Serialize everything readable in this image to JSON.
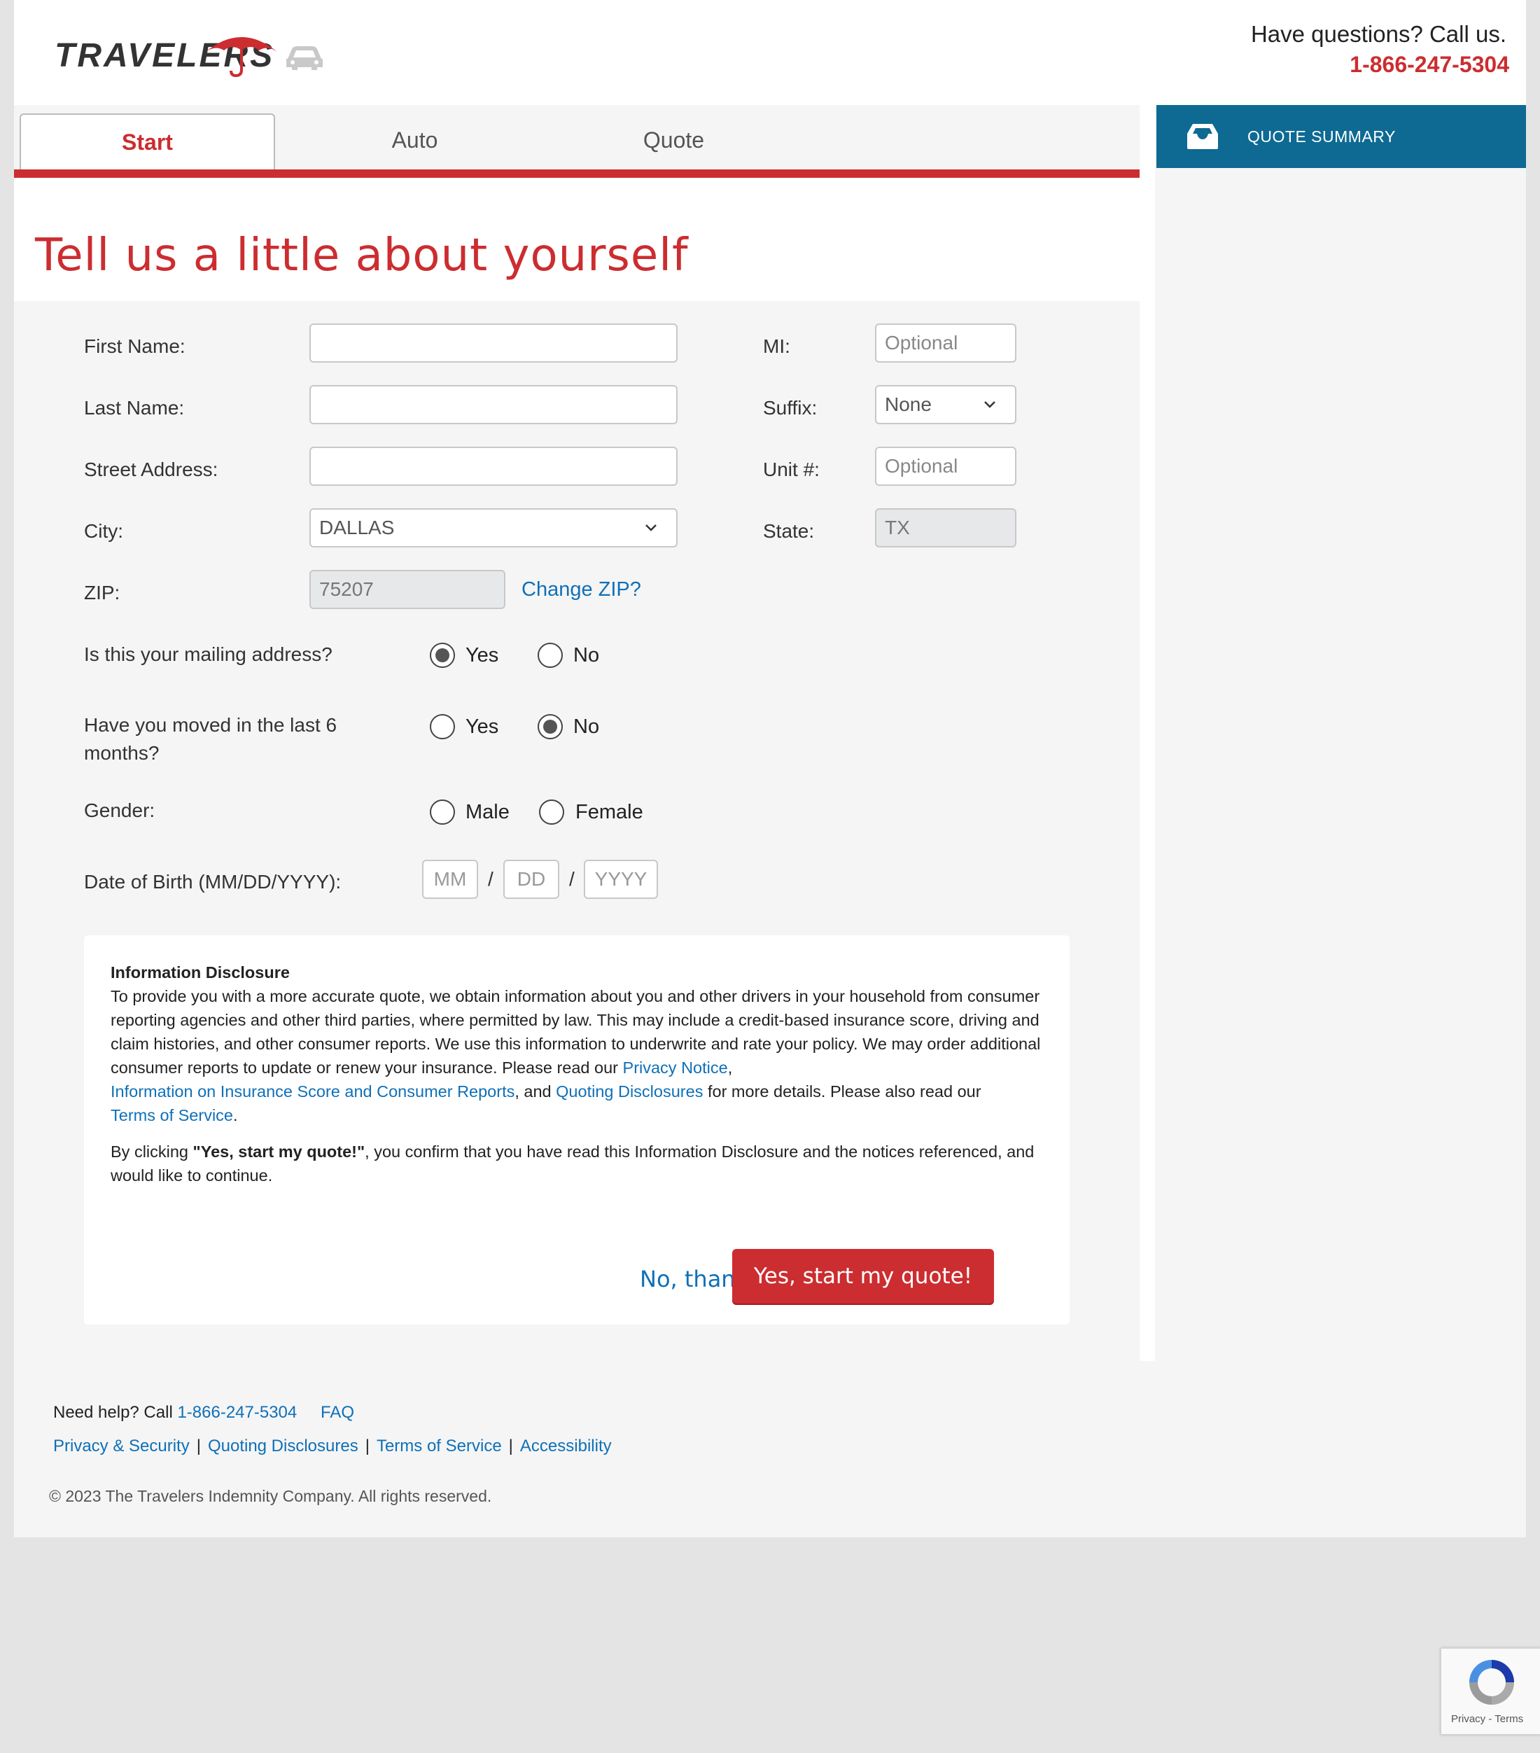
{
  "header": {
    "logo_text": "TRAVELERS",
    "help_question": "Have questions? Call us.",
    "phone": "1-866-247-5304"
  },
  "tabs": [
    {
      "label": "Start",
      "active": true
    },
    {
      "label": "Auto",
      "active": false
    },
    {
      "label": "Quote",
      "active": false
    }
  ],
  "sidebar": {
    "quote_summary_label": "QUOTE SUMMARY"
  },
  "page_title": "Tell us a little about yourself",
  "form": {
    "first_name": {
      "label": "First Name:",
      "value": ""
    },
    "mi": {
      "label": "MI:",
      "placeholder": "Optional"
    },
    "last_name": {
      "label": "Last Name:",
      "value": ""
    },
    "suffix": {
      "label": "Suffix:",
      "value": "None"
    },
    "street": {
      "label": "Street Address:",
      "value": ""
    },
    "unit": {
      "label": "Unit #:",
      "placeholder": "Optional"
    },
    "city": {
      "label": "City:",
      "value": "DALLAS"
    },
    "state": {
      "label": "State:",
      "value": "TX"
    },
    "zip": {
      "label": "ZIP:",
      "value": "75207",
      "change_link": "Change ZIP?"
    },
    "mailing": {
      "question": "Is this your mailing address?",
      "yes": "Yes",
      "no": "No",
      "selected": "Yes"
    },
    "moved": {
      "question": "Have you moved in the last 6 months?",
      "yes": "Yes",
      "no": "No",
      "selected": "No"
    },
    "gender": {
      "label": "Gender:",
      "male": "Male",
      "female": "Female",
      "selected": null
    },
    "dob": {
      "label": "Date of Birth (MM/DD/YYYY):",
      "mm": "MM",
      "dd": "DD",
      "yyyy": "YYYY",
      "sep": "/"
    }
  },
  "disclosure": {
    "title": "Information Disclosure",
    "p1_a": "To provide you with a more accurate quote, we obtain information about you and other drivers in your household from consumer reporting agencies and other third parties, where permitted by law. This may include a credit-based insurance score, driving and claim histories, and other consumer reports. We use this information to underwrite and rate your policy. We may order additional consumer reports to update or renew your insurance. Please read our ",
    "link_privacy": "Privacy Notice",
    "p1_b": ",",
    "link_insurance_score": "Information on Insurance Score and Consumer Reports",
    "p1_c": ", and ",
    "link_quoting": "Quoting Disclosures",
    "p1_d": " for more details. Please also read our ",
    "link_terms": "Terms of Service",
    "p1_e": ".",
    "p2_a": "By clicking ",
    "p2_bold": "\"Yes, start my quote!\"",
    "p2_b": ", you confirm that you have read this Information Disclosure and the notices referenced, and would like to continue.",
    "no_thanks": "No, thanks",
    "yes_start": "Yes, start my quote!"
  },
  "footer": {
    "need_help": "Need help? Call ",
    "phone": "1-866-247-5304",
    "faq": "FAQ",
    "links": [
      "Privacy & Security",
      "Quoting Disclosures",
      "Terms of Service",
      "Accessibility"
    ],
    "copyright": "© 2023 The Travelers Indemnity Company. All rights reserved."
  },
  "recaptcha": {
    "privacy": "Privacy",
    "dash": " - ",
    "terms": "Terms"
  },
  "colors": {
    "brand_red": "#cc2d30",
    "link_blue": "#0f70b7",
    "summary_blue": "#0e6a93"
  }
}
